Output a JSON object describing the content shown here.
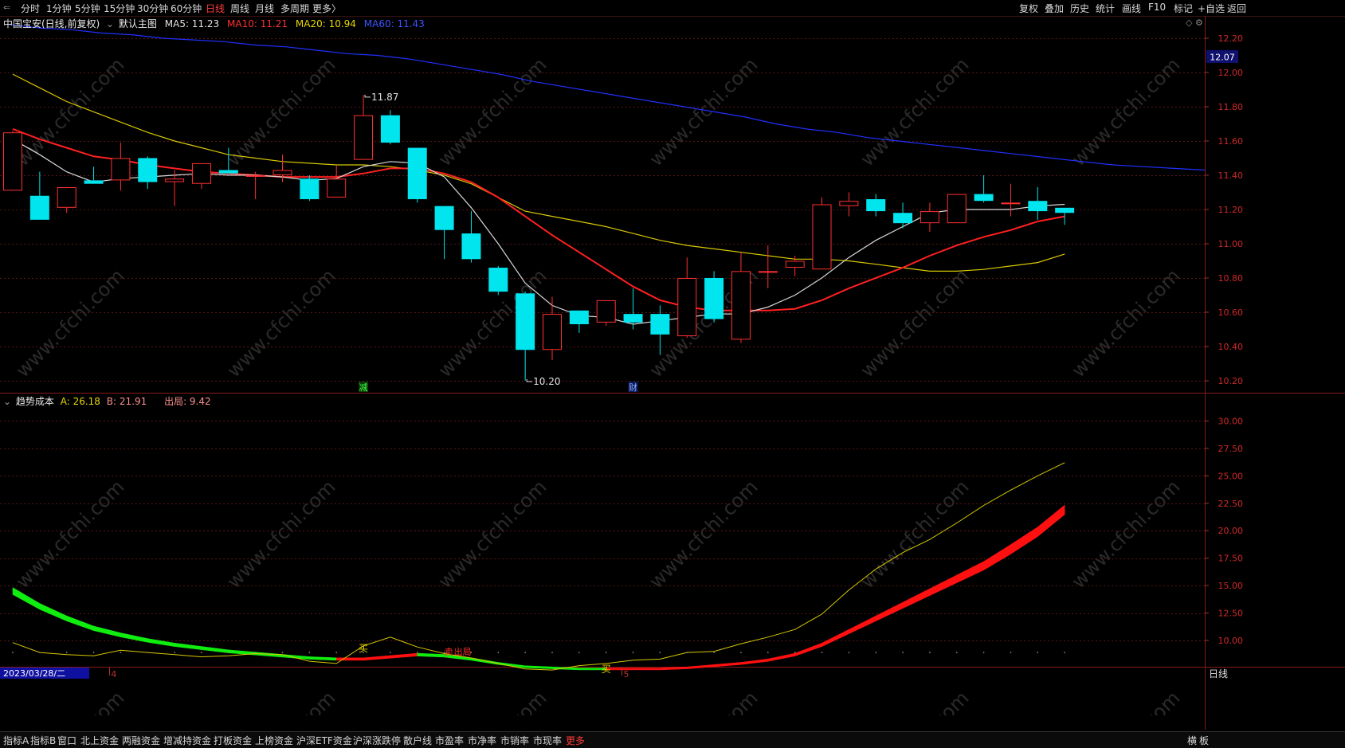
{
  "period_tabs": [
    {
      "label": "分时",
      "active": false
    },
    {
      "label": "1分钟",
      "active": false
    },
    {
      "label": "5分钟",
      "active": false
    },
    {
      "label": "15分钟",
      "active": false
    },
    {
      "label": "30分钟",
      "active": false
    },
    {
      "label": "60分钟",
      "active": false
    },
    {
      "label": "日线",
      "active": true
    },
    {
      "label": "周线",
      "active": false
    },
    {
      "label": "月线",
      "active": false
    },
    {
      "label": "多周期",
      "active": false
    },
    {
      "label": "更多",
      "active": false
    }
  ],
  "more_arrow": "〉",
  "tools": [
    "复权",
    "叠加",
    "历史",
    "统计",
    "画线",
    "F10",
    "标记",
    "+自选",
    "返回"
  ],
  "main_info": {
    "title": "中国宝安(日线,前复权)",
    "indicator": "默认主图",
    "ma5": "MA5: 11.23",
    "ma10": "MA10: 11.21",
    "ma20": "MA20: 10.94",
    "ma60": "MA60: 11.43"
  },
  "sub_info": {
    "name": "趋势成本",
    "a": "A: 26.18",
    "b": "B: 21.91",
    "out": "出局: 9.42"
  },
  "price_axis": [
    "12.20",
    "12.00",
    "11.80",
    "11.60",
    "11.40",
    "11.20",
    "11.00",
    "10.80",
    "10.60",
    "10.40",
    "10.20"
  ],
  "price_current": "12.07",
  "sub_axis": [
    "30.00",
    "27.50",
    "25.00",
    "22.50",
    "20.00",
    "17.50",
    "15.00",
    "12.50",
    "10.00"
  ],
  "annotations": {
    "high": "11.87",
    "low": "10.20",
    "jian": "减",
    "cai": "财",
    "buy": "买",
    "sell": "卖",
    "chuju": "出局"
  },
  "date_cursor": "2023/03/28/二",
  "month_labels": [
    "4",
    "5"
  ],
  "period_label": "日线",
  "bottom_tabs": [
    "指标A",
    "指标B",
    "窗口",
    "北上资金",
    "两融资金",
    "增减持资金",
    "打板资金",
    "上榜资金",
    "沪深ETF资金",
    "沪深涨跌停",
    "散户线",
    "市盈率",
    "市净率",
    "市销率",
    "市现率",
    "更多"
  ],
  "bottom_right": [
    "横",
    "板"
  ],
  "colors": {
    "up": "#ff3030",
    "down": "#00e5ee",
    "ma5": "#d8d8d8",
    "ma10": "#ff2020",
    "ma20": "#d8c800",
    "ma60": "#2030ff",
    "grid": "#5a1515",
    "bandUp": "#ff1010",
    "bandDown": "#10ee10",
    "cost": "#d8c800"
  },
  "chart_data": [
    {
      "type": "candlestick",
      "title": "中国宝安(日线,前复权)",
      "ylim": [
        10.13,
        12.33
      ],
      "candles": [
        {
          "o": 11.31,
          "h": 11.66,
          "l": 11.31,
          "c": 11.65
        },
        {
          "o": 11.28,
          "h": 11.42,
          "l": 11.18,
          "c": 11.14
        },
        {
          "o": 11.21,
          "h": 11.33,
          "l": 11.18,
          "c": 11.33
        },
        {
          "o": 11.37,
          "h": 11.45,
          "l": 11.35,
          "c": 11.35
        },
        {
          "o": 11.37,
          "h": 11.59,
          "l": 11.31,
          "c": 11.5
        },
        {
          "o": 11.5,
          "h": 11.51,
          "l": 11.32,
          "c": 11.36
        },
        {
          "o": 11.36,
          "h": 11.43,
          "l": 11.22,
          "c": 11.38
        },
        {
          "o": 11.35,
          "h": 11.47,
          "l": 11.32,
          "c": 11.47
        },
        {
          "o": 11.43,
          "h": 11.56,
          "l": 11.41,
          "c": 11.41
        },
        {
          "o": 11.4,
          "h": 11.42,
          "l": 11.26,
          "c": 11.4
        },
        {
          "o": 11.4,
          "h": 11.52,
          "l": 11.36,
          "c": 11.43
        },
        {
          "o": 11.38,
          "h": 11.4,
          "l": 11.25,
          "c": 11.26
        },
        {
          "o": 11.27,
          "h": 11.46,
          "l": 11.27,
          "c": 11.38
        },
        {
          "o": 11.49,
          "h": 11.87,
          "l": 11.49,
          "c": 11.75
        },
        {
          "o": 11.75,
          "h": 11.78,
          "l": 11.58,
          "c": 11.59
        },
        {
          "o": 11.56,
          "h": 11.56,
          "l": 11.24,
          "c": 11.26
        },
        {
          "o": 11.22,
          "h": 11.22,
          "l": 10.91,
          "c": 11.08
        },
        {
          "o": 11.06,
          "h": 11.19,
          "l": 10.89,
          "c": 10.91
        },
        {
          "o": 10.86,
          "h": 10.87,
          "l": 10.7,
          "c": 10.72
        },
        {
          "o": 10.71,
          "h": 10.72,
          "l": 10.2,
          "c": 10.38
        },
        {
          "o": 10.38,
          "h": 10.69,
          "l": 10.32,
          "c": 10.59
        },
        {
          "o": 10.61,
          "h": 10.61,
          "l": 10.48,
          "c": 10.53
        },
        {
          "o": 10.54,
          "h": 10.67,
          "l": 10.52,
          "c": 10.67
        },
        {
          "o": 10.59,
          "h": 10.74,
          "l": 10.5,
          "c": 10.54
        },
        {
          "o": 10.59,
          "h": 10.64,
          "l": 10.35,
          "c": 10.47
        },
        {
          "o": 10.46,
          "h": 10.92,
          "l": 10.45,
          "c": 10.8
        },
        {
          "o": 10.8,
          "h": 10.84,
          "l": 10.54,
          "c": 10.56
        },
        {
          "o": 10.44,
          "h": 10.95,
          "l": 10.42,
          "c": 10.84
        },
        {
          "o": 10.84,
          "h": 10.99,
          "l": 10.74,
          "c": 10.84
        },
        {
          "o": 10.86,
          "h": 10.93,
          "l": 10.81,
          "c": 10.9
        },
        {
          "o": 10.85,
          "h": 11.27,
          "l": 10.85,
          "c": 11.23
        },
        {
          "o": 11.22,
          "h": 11.3,
          "l": 11.16,
          "c": 11.25
        },
        {
          "o": 11.26,
          "h": 11.29,
          "l": 11.16,
          "c": 11.19
        },
        {
          "o": 11.18,
          "h": 11.24,
          "l": 11.09,
          "c": 11.12
        },
        {
          "o": 11.12,
          "h": 11.24,
          "l": 11.07,
          "c": 11.19
        },
        {
          "o": 11.12,
          "h": 11.29,
          "l": 11.12,
          "c": 11.29
        },
        {
          "o": 11.29,
          "h": 11.4,
          "l": 11.24,
          "c": 11.25
        },
        {
          "o": 11.24,
          "h": 11.35,
          "l": 11.16,
          "c": 11.24
        },
        {
          "o": 11.25,
          "h": 11.33,
          "l": 11.14,
          "c": 11.19
        },
        {
          "o": 11.21,
          "h": 11.21,
          "l": 11.11,
          "c": 11.18
        }
      ],
      "series": [
        {
          "name": "MA5",
          "values": [
            11.61,
            11.52,
            11.42,
            11.36,
            11.38,
            11.39,
            11.4,
            11.41,
            11.4,
            11.4,
            11.39,
            11.37,
            11.38,
            11.45,
            11.48,
            11.47,
            11.39,
            11.21,
            11.0,
            10.77,
            10.64,
            10.58,
            10.57,
            10.53,
            10.55,
            10.57,
            10.59,
            10.59,
            10.63,
            10.7,
            10.8,
            10.92,
            11.02,
            11.1,
            11.18,
            11.2,
            11.2,
            11.2,
            11.22,
            11.23
          ]
        },
        {
          "name": "MA10",
          "values": [
            11.67,
            11.61,
            11.56,
            11.51,
            11.49,
            11.46,
            11.44,
            11.42,
            11.41,
            11.4,
            11.39,
            11.39,
            11.39,
            11.41,
            11.44,
            11.44,
            11.41,
            11.36,
            11.27,
            11.16,
            11.05,
            10.95,
            10.85,
            10.75,
            10.67,
            10.63,
            10.61,
            10.61,
            10.61,
            10.62,
            10.67,
            10.74,
            10.8,
            10.86,
            10.93,
            10.99,
            11.04,
            11.08,
            11.13,
            11.16
          ]
        },
        {
          "name": "MA20",
          "values": [
            11.99,
            11.91,
            11.83,
            11.77,
            11.71,
            11.65,
            11.6,
            11.56,
            11.52,
            11.5,
            11.48,
            11.47,
            11.46,
            11.46,
            11.45,
            11.43,
            11.4,
            11.35,
            11.27,
            11.19,
            11.16,
            11.13,
            11.1,
            11.06,
            11.02,
            10.99,
            10.97,
            10.95,
            10.93,
            10.91,
            10.91,
            10.9,
            10.88,
            10.86,
            10.84,
            10.84,
            10.85,
            10.87,
            10.89,
            10.94
          ]
        },
        {
          "name": "MA60",
          "values": [
            12.28,
            12.26,
            12.25,
            12.23,
            12.22,
            12.2,
            12.19,
            12.18,
            12.16,
            12.15,
            12.13,
            12.11,
            12.1,
            12.08,
            12.05,
            12.02,
            11.99,
            11.95,
            11.92,
            11.89,
            11.86,
            11.83,
            11.8,
            11.77,
            11.74,
            11.7,
            11.67,
            11.65,
            11.62,
            11.6,
            11.58,
            11.56,
            11.54,
            11.52,
            11.5,
            11.48,
            11.46,
            11.45,
            11.44,
            11.43
          ]
        }
      ]
    },
    {
      "type": "line",
      "title": "趋势成本",
      "ylim": [
        7.6,
        32.5
      ],
      "series": [
        {
          "name": "A",
          "values": [
            9.8,
            8.9,
            8.7,
            8.6,
            9.1,
            8.9,
            8.7,
            8.5,
            8.6,
            8.8,
            8.7,
            8.1,
            7.9,
            9.5,
            10.3,
            9.4,
            8.8,
            8.4,
            7.9,
            7.4,
            7.3,
            7.7,
            7.9,
            8.2,
            8.3,
            8.9,
            9.0,
            9.7,
            10.3,
            11.0,
            12.4,
            14.6,
            16.5,
            18.0,
            19.2,
            20.7,
            22.3,
            23.7,
            25.0,
            26.2
          ]
        },
        {
          "name": "B",
          "values": [
            14.5,
            13.1,
            12.0,
            11.1,
            10.5,
            10.0,
            9.6,
            9.3,
            9.0,
            8.8,
            8.6,
            8.4,
            8.3,
            8.3,
            8.5,
            8.7,
            8.6,
            8.3,
            7.9,
            7.6,
            7.5,
            7.4,
            7.4,
            7.4,
            7.4,
            7.5,
            7.7,
            7.9,
            8.2,
            8.7,
            9.6,
            10.8,
            12.0,
            13.2,
            14.4,
            15.6,
            16.8,
            18.3,
            19.9,
            21.9
          ]
        }
      ],
      "band_up_flags": [
        false,
        false,
        false,
        false,
        false,
        false,
        false,
        false,
        false,
        false,
        false,
        false,
        false,
        true,
        true,
        true,
        false,
        false,
        false,
        false,
        false,
        false,
        false,
        true,
        true,
        true,
        true,
        true,
        true,
        true,
        true,
        true,
        true,
        true,
        true,
        true,
        true,
        true,
        true,
        true
      ]
    }
  ]
}
